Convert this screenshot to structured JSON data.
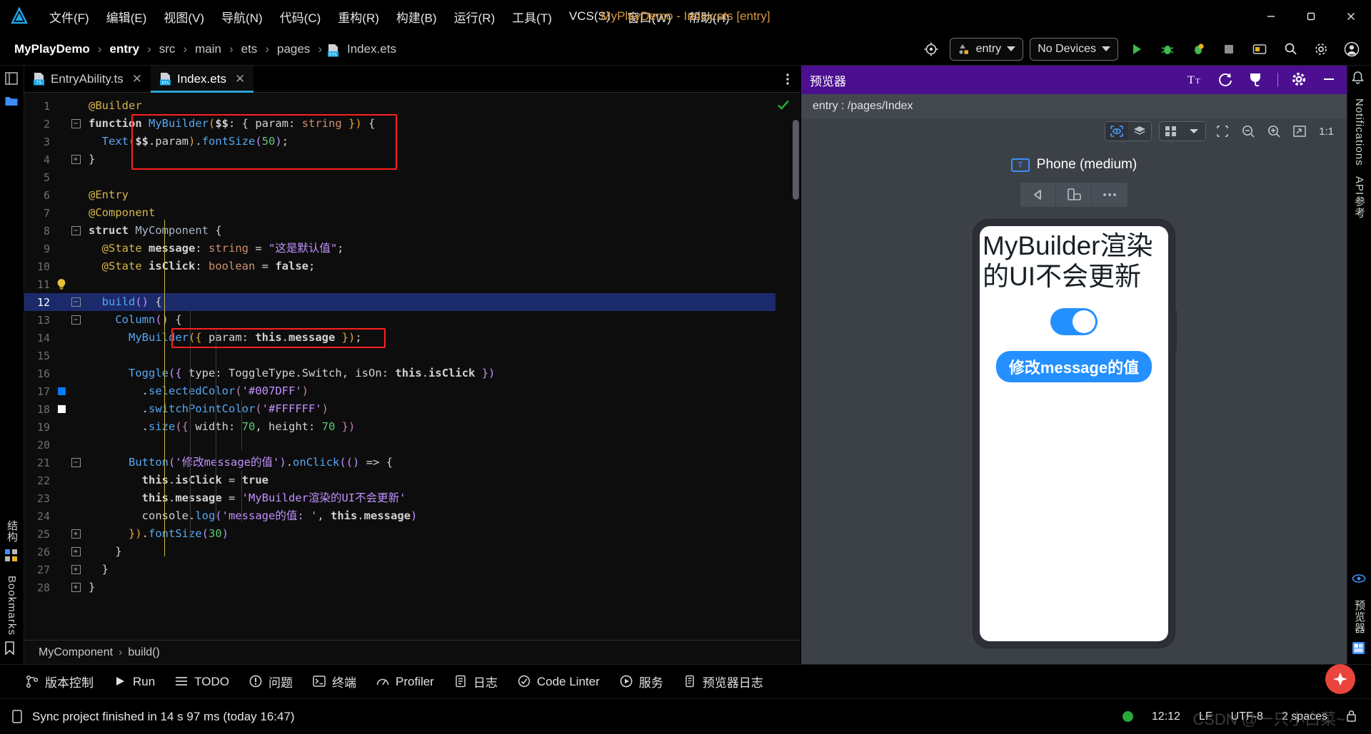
{
  "titlebar": {
    "logo_icon": "deveco-logo-icon",
    "menus": [
      {
        "label": "文件(F)"
      },
      {
        "label": "编辑(E)"
      },
      {
        "label": "视图(V)"
      },
      {
        "label": "导航(N)"
      },
      {
        "label": "代码(C)"
      },
      {
        "label": "重构(R)"
      },
      {
        "label": "构建(B)"
      },
      {
        "label": "运行(R)"
      },
      {
        "label": "工具(T)"
      },
      {
        "label": "VCS(S)"
      },
      {
        "label": "窗口(W)"
      },
      {
        "label": "帮助(H)"
      }
    ],
    "window_title": "MyPlayDemo - Index.ets [entry]",
    "window_title_color": "#d9963a",
    "minimize": "—",
    "maximize": "▢",
    "close": "✕"
  },
  "navbar": {
    "breadcrumbs": [
      "MyPlayDemo",
      "entry",
      "src",
      "main",
      "ets",
      "pages",
      "Index.ets"
    ],
    "separator": "›",
    "run_config": "entry",
    "device_select": "No Devices",
    "icons": [
      "target-icon",
      "run-icon",
      "debug-icon",
      "profile-icon",
      "stop-icon",
      "device-manager-icon",
      "search-icon",
      "settings-icon",
      "account-icon"
    ]
  },
  "left_strip": {
    "icons": [
      "project-icon",
      "structure-grid-icon",
      "bookmark-icon"
    ],
    "labels": [
      "结构",
      "Bookmarks"
    ]
  },
  "right_strip": {
    "labels": [
      "Notifications",
      "API参考",
      "预览器"
    ]
  },
  "editor": {
    "tabs": [
      {
        "label": "EntryAbility.ts",
        "badge": "TS",
        "active": false,
        "close": "✕"
      },
      {
        "label": "Index.ets",
        "badge": "ETS",
        "active": true,
        "close": "✕"
      }
    ],
    "more_icon": "vertical-dots-icon",
    "inspection_ok_icon": "green-check-icon",
    "current_line": 12,
    "lines": [
      {
        "n": 1,
        "fold": "",
        "mark": "",
        "tokens": [
          {
            "t": "@Builder",
            "c": "t-anno"
          }
        ],
        "indent": 1
      },
      {
        "n": 2,
        "fold": "-",
        "mark": "",
        "tokens": [
          {
            "t": "function ",
            "c": "t-kw"
          },
          {
            "t": "MyBuilder",
            "c": "t-fn"
          },
          {
            "t": "(",
            "c": "t-par"
          },
          {
            "t": "$$",
            "c": "t-field"
          },
          {
            "t": ": { ",
            "c": "t-pl"
          },
          {
            "t": "param",
            "c": "t-pl"
          },
          {
            "t": ": ",
            "c": "t-pl"
          },
          {
            "t": "string",
            "c": "t-type"
          },
          {
            "t": " })",
            "c": "t-par"
          },
          {
            "t": " {",
            "c": "t-pl"
          }
        ],
        "indent": 1
      },
      {
        "n": 3,
        "fold": "",
        "mark": "",
        "tokens": [
          {
            "t": "  ",
            "c": "t-pl"
          },
          {
            "t": "Text",
            "c": "t-fn"
          },
          {
            "t": "(",
            "c": "t-par"
          },
          {
            "t": "$$",
            "c": "t-field"
          },
          {
            "t": ".",
            "c": "t-pl"
          },
          {
            "t": "param",
            "c": "t-pl"
          },
          {
            "t": ")",
            "c": "t-par"
          },
          {
            "t": ".",
            "c": "t-pl"
          },
          {
            "t": "fontSize",
            "c": "t-meth"
          },
          {
            "t": "(",
            "c": "t-purp"
          },
          {
            "t": "50",
            "c": "t-num"
          },
          {
            "t": ")",
            "c": "t-purp"
          },
          {
            "t": ";",
            "c": "t-pl"
          }
        ],
        "indent": 1
      },
      {
        "n": 4,
        "fold": "+",
        "mark": "",
        "tokens": [
          {
            "t": "}",
            "c": "t-pl"
          }
        ],
        "indent": 1
      },
      {
        "n": 5,
        "fold": "",
        "mark": "",
        "tokens": [],
        "indent": 0
      },
      {
        "n": 6,
        "fold": "",
        "mark": "",
        "tokens": [
          {
            "t": "@Entry",
            "c": "t-anno"
          }
        ],
        "indent": 1
      },
      {
        "n": 7,
        "fold": "",
        "mark": "",
        "tokens": [
          {
            "t": "@Component",
            "c": "t-anno"
          }
        ],
        "indent": 1
      },
      {
        "n": 8,
        "fold": "-",
        "mark": "",
        "tokens": [
          {
            "t": "struct ",
            "c": "t-kw"
          },
          {
            "t": "MyComponent",
            "c": "t-cls"
          },
          {
            "t": " {",
            "c": "t-pl"
          }
        ],
        "indent": 1
      },
      {
        "n": 9,
        "fold": "",
        "mark": "",
        "tokens": [
          {
            "t": "  ",
            "c": "t-pl"
          },
          {
            "t": "@State ",
            "c": "t-anno"
          },
          {
            "t": "message",
            "c": "t-field"
          },
          {
            "t": ": ",
            "c": "t-pl"
          },
          {
            "t": "string",
            "c": "t-type"
          },
          {
            "t": " = ",
            "c": "t-pl"
          },
          {
            "t": "\"这是默认值\"",
            "c": "t-str"
          },
          {
            "t": ";",
            "c": "t-pl"
          }
        ],
        "indent": 1
      },
      {
        "n": 10,
        "fold": "",
        "mark": "",
        "tokens": [
          {
            "t": "  ",
            "c": "t-pl"
          },
          {
            "t": "@State ",
            "c": "t-anno"
          },
          {
            "t": "isClick",
            "c": "t-field"
          },
          {
            "t": ": ",
            "c": "t-pl"
          },
          {
            "t": "boolean",
            "c": "t-type"
          },
          {
            "t": " = ",
            "c": "t-pl"
          },
          {
            "t": "false",
            "c": "t-kw"
          },
          {
            "t": ";",
            "c": "t-pl"
          }
        ],
        "indent": 1
      },
      {
        "n": 11,
        "fold": "",
        "mark": "bulb",
        "tokens": [],
        "indent": 1
      },
      {
        "n": 12,
        "fold": "-",
        "mark": "",
        "tokens": [
          {
            "t": "  ",
            "c": "t-pl"
          },
          {
            "t": "build",
            "c": "t-fn"
          },
          {
            "t": "()",
            "c": "t-purp"
          },
          {
            "t": " {",
            "c": "t-pl"
          }
        ],
        "indent": 1
      },
      {
        "n": 13,
        "fold": "-",
        "mark": "",
        "tokens": [
          {
            "t": "    ",
            "c": "t-pl"
          },
          {
            "t": "Column",
            "c": "t-fn"
          },
          {
            "t": "()",
            "c": "t-purp"
          },
          {
            "t": " {",
            "c": "t-pl"
          }
        ],
        "indent": 2
      },
      {
        "n": 14,
        "fold": "",
        "mark": "",
        "tokens": [
          {
            "t": "      ",
            "c": "t-pl"
          },
          {
            "t": "MyBuilder",
            "c": "t-fn"
          },
          {
            "t": "({",
            "c": "t-par"
          },
          {
            "t": " param",
            "c": "t-pl"
          },
          {
            "t": ": ",
            "c": "t-pl"
          },
          {
            "t": "this",
            "c": "t-kw"
          },
          {
            "t": ".",
            "c": "t-pl"
          },
          {
            "t": "message",
            "c": "t-field"
          },
          {
            "t": " }",
            "c": "t-par"
          },
          {
            "t": ")",
            "c": "t-par"
          },
          {
            "t": ";",
            "c": "t-pl"
          }
        ],
        "indent": 3
      },
      {
        "n": 15,
        "fold": "",
        "mark": "",
        "tokens": [],
        "indent": 3
      },
      {
        "n": 16,
        "fold": "",
        "mark": "",
        "tokens": [
          {
            "t": "      ",
            "c": "t-pl"
          },
          {
            "t": "Toggle",
            "c": "t-fn"
          },
          {
            "t": "({",
            "c": "t-purp"
          },
          {
            "t": " type",
            "c": "t-pl"
          },
          {
            "t": ": ",
            "c": "t-pl"
          },
          {
            "t": "ToggleType",
            "c": "t-pl"
          },
          {
            "t": ".",
            "c": "t-pl"
          },
          {
            "t": "Switch",
            "c": "t-pl"
          },
          {
            "t": ", isOn",
            "c": "t-pl"
          },
          {
            "t": ": ",
            "c": "t-pl"
          },
          {
            "t": "this",
            "c": "t-kw"
          },
          {
            "t": ".",
            "c": "t-pl"
          },
          {
            "t": "isClick",
            "c": "t-field"
          },
          {
            "t": " }",
            "c": "t-purp"
          },
          {
            "t": ")",
            "c": "t-purp"
          }
        ],
        "indent": 3
      },
      {
        "n": 17,
        "fold": "",
        "mark": "blue",
        "tokens": [
          {
            "t": "        ",
            "c": "t-pl"
          },
          {
            "t": ".",
            "c": "t-pl"
          },
          {
            "t": "selectedColor",
            "c": "t-meth"
          },
          {
            "t": "(",
            "c": "t-prop"
          },
          {
            "t": "'#007DFF'",
            "c": "t-str"
          },
          {
            "t": ")",
            "c": "t-prop"
          }
        ],
        "indent": 4
      },
      {
        "n": 18,
        "fold": "",
        "mark": "white",
        "tokens": [
          {
            "t": "        ",
            "c": "t-pl"
          },
          {
            "t": ".",
            "c": "t-pl"
          },
          {
            "t": "switchPointColor",
            "c": "t-meth"
          },
          {
            "t": "(",
            "c": "t-prop"
          },
          {
            "t": "'#FFFFFF'",
            "c": "t-str"
          },
          {
            "t": ")",
            "c": "t-prop"
          }
        ],
        "indent": 4
      },
      {
        "n": 19,
        "fold": "",
        "mark": "",
        "tokens": [
          {
            "t": "        ",
            "c": "t-pl"
          },
          {
            "t": ".",
            "c": "t-pl"
          },
          {
            "t": "size",
            "c": "t-meth"
          },
          {
            "t": "({",
            "c": "t-prop"
          },
          {
            "t": " width",
            "c": "t-pl"
          },
          {
            "t": ": ",
            "c": "t-pl"
          },
          {
            "t": "70",
            "c": "t-num"
          },
          {
            "t": ", height",
            "c": "t-pl"
          },
          {
            "t": ": ",
            "c": "t-pl"
          },
          {
            "t": "70",
            "c": "t-num"
          },
          {
            "t": " }",
            "c": "t-prop"
          },
          {
            "t": ")",
            "c": "t-prop"
          }
        ],
        "indent": 4
      },
      {
        "n": 20,
        "fold": "",
        "mark": "",
        "tokens": [],
        "indent": 3
      },
      {
        "n": 21,
        "fold": "-",
        "mark": "",
        "tokens": [
          {
            "t": "      ",
            "c": "t-pl"
          },
          {
            "t": "Button",
            "c": "t-fn"
          },
          {
            "t": "(",
            "c": "t-purp"
          },
          {
            "t": "'修改message的值'",
            "c": "t-str"
          },
          {
            "t": ")",
            "c": "t-purp"
          },
          {
            "t": ".",
            "c": "t-pl"
          },
          {
            "t": "onClick",
            "c": "t-meth"
          },
          {
            "t": "((",
            "c": "t-purp"
          },
          {
            "t": ")",
            "c": "t-purp"
          },
          {
            "t": " => {",
            "c": "t-pl"
          }
        ],
        "indent": 3
      },
      {
        "n": 22,
        "fold": "",
        "mark": "",
        "tokens": [
          {
            "t": "        ",
            "c": "t-pl"
          },
          {
            "t": "this",
            "c": "t-kw"
          },
          {
            "t": ".",
            "c": "t-pl"
          },
          {
            "t": "isClick",
            "c": "t-field"
          },
          {
            "t": " = ",
            "c": "t-pl"
          },
          {
            "t": "true",
            "c": "t-kw"
          }
        ],
        "indent": 4
      },
      {
        "n": 23,
        "fold": "",
        "mark": "",
        "tokens": [
          {
            "t": "        ",
            "c": "t-pl"
          },
          {
            "t": "this",
            "c": "t-kw"
          },
          {
            "t": ".",
            "c": "t-pl"
          },
          {
            "t": "message",
            "c": "t-field"
          },
          {
            "t": " = ",
            "c": "t-pl"
          },
          {
            "t": "'MyBuilder渲染的UI不会更新'",
            "c": "t-str"
          }
        ],
        "indent": 4
      },
      {
        "n": 24,
        "fold": "",
        "mark": "",
        "tokens": [
          {
            "t": "        ",
            "c": "t-pl"
          },
          {
            "t": "console",
            "c": "t-pl"
          },
          {
            "t": ".",
            "c": "t-pl"
          },
          {
            "t": "log",
            "c": "t-meth"
          },
          {
            "t": "(",
            "c": "t-purp"
          },
          {
            "t": "'message的值: '",
            "c": "t-str"
          },
          {
            "t": ", ",
            "c": "t-pl"
          },
          {
            "t": "this",
            "c": "t-kw"
          },
          {
            "t": ".",
            "c": "t-pl"
          },
          {
            "t": "message",
            "c": "t-field"
          },
          {
            "t": ")",
            "c": "t-purp"
          }
        ],
        "indent": 4
      },
      {
        "n": 25,
        "fold": "+",
        "mark": "",
        "tokens": [
          {
            "t": "      ",
            "c": "t-pl"
          },
          {
            "t": "})",
            "c": "t-par"
          },
          {
            "t": ".",
            "c": "t-pl"
          },
          {
            "t": "fontSize",
            "c": "t-meth"
          },
          {
            "t": "(",
            "c": "t-purp"
          },
          {
            "t": "30",
            "c": "t-num"
          },
          {
            "t": ")",
            "c": "t-purp"
          }
        ],
        "indent": 3
      },
      {
        "n": 26,
        "fold": "+",
        "mark": "",
        "tokens": [
          {
            "t": "    ",
            "c": "t-pl"
          },
          {
            "t": "}",
            "c": "t-pl"
          }
        ],
        "indent": 2
      },
      {
        "n": 27,
        "fold": "+",
        "mark": "",
        "tokens": [
          {
            "t": "  ",
            "c": "t-pl"
          },
          {
            "t": "}",
            "c": "t-pl"
          }
        ],
        "indent": 1
      },
      {
        "n": 28,
        "fold": "+",
        "mark": "",
        "tokens": [
          {
            "t": "}",
            "c": "t-pl"
          }
        ],
        "indent": 1
      }
    ],
    "highlight_color": "#ff1f1f",
    "breadcrumb": [
      "MyComponent",
      "build()"
    ],
    "breadcrumb_sep": "›"
  },
  "previewer": {
    "title": "预览器",
    "head_icons": [
      "font-size-icon",
      "refresh-icon",
      "inspector-icon",
      "gear-icon",
      "minimize-icon"
    ],
    "path": "entry : /pages/Index",
    "toolbar_icons": [
      "eye-inspect-icon",
      "layers-icon",
      "grid-icon",
      "chevron-down-icon",
      "frame-icon",
      "zoom-out-icon",
      "zoom-in-icon",
      "fit-screen-icon"
    ],
    "zoom_ratio": "1:1",
    "device_name": "Phone (medium)",
    "device_badge": "T",
    "device_ctrl_icons": [
      "back-icon",
      "rotate-icon",
      "more-icon"
    ],
    "phone": {
      "text": "MyBuilder渲染的UI不会更新",
      "switch_on": true,
      "switch_color": "#2490ff",
      "button_label": "修改message的值",
      "button_color": "#2490ff"
    }
  },
  "toolwindows": [
    {
      "label": "版本控制",
      "icon": "branch-icon"
    },
    {
      "label": "Run",
      "icon": "play-icon"
    },
    {
      "label": "TODO",
      "icon": "list-icon"
    },
    {
      "label": "问题",
      "icon": "warning-icon"
    },
    {
      "label": "终端",
      "icon": "terminal-icon"
    },
    {
      "label": "Profiler",
      "icon": "profiler-icon"
    },
    {
      "label": "日志",
      "icon": "log-icon"
    },
    {
      "label": "Code Linter",
      "icon": "linter-icon"
    },
    {
      "label": "服务",
      "icon": "services-icon"
    },
    {
      "label": "预览器日志",
      "icon": "preview-log-icon"
    }
  ],
  "statusbar": {
    "icon": "device-icon",
    "message": "Sync project finished in 14 s 97 ms (today 16:47)",
    "indicator_color": "#2aa83a",
    "time": "12:12",
    "line_sep": "LF",
    "encoding": "UTF-8",
    "indent": "2 spaces",
    "lock_icon": "lock-icon",
    "watermark": "CSDN @一只小白菜~"
  }
}
